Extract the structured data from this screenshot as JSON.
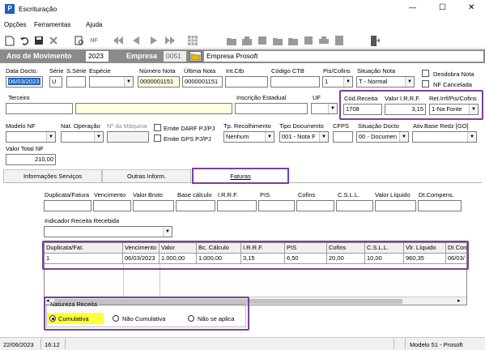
{
  "window": {
    "title": "Escrituração",
    "minimize": "—",
    "maximize": "☐",
    "close": "✕"
  },
  "menu": [
    "Opções",
    "Ferramentas",
    "Ajuda"
  ],
  "movement": {
    "label": "Ano de Movimento",
    "year": "2023",
    "company_label": "Empresa",
    "company_code": "0051",
    "company_name": "Empresa Prosoft"
  },
  "row1": {
    "data_docto_label": "Data Docto.",
    "data_docto": "06/03/2023",
    "serie_label": "Série",
    "serie": "U",
    "subserie_label": "S.Série",
    "especie_label": "Espécie",
    "numero_nota_label": "Número Nota",
    "numero_nota": "0000001151",
    "ultima_nota_label": "Última Nota",
    "ultima_nota": "0000001151",
    "int_ctb_label": "Int.Ctb",
    "cod_ctb_label": "Código CTB",
    "pis_cofins_label": "Pis/Cofins",
    "pis_cofins": "1",
    "situacao_label": "Situação Nota",
    "situacao": "T - Normal",
    "desdobra_label": "Desdobra Nota",
    "cancelada_label": "NF Cancelada"
  },
  "row2": {
    "terceiro_label": "Terceiro",
    "insc_label": "Inscrição Estadual",
    "uf_label": "UF",
    "cod_receita_label": "Cód.Receita",
    "cod_receita": "1708",
    "valor_irrf_label": "Valor I.R.R.F.",
    "valor_irrf": "3,15",
    "ret_label": "Ret.Irrf/Pis/Cofins",
    "ret": "1-Na Fonte"
  },
  "row3": {
    "modelo_label": "Modelo NF",
    "nat_op_label": "Nat. Operação",
    "maquina_label": "Nº da Máquina",
    "darf_label": "Emite DARF PJ/PJ",
    "gps_label": "Emite GPS PJ/PJ",
    "tp_rec_label": "Tp. Recolhimento",
    "tp_rec": "Nenhum",
    "tipo_doc_label": "Tipo Documento",
    "tipo_doc": "001 - Nota F",
    "cfps_label": "CFPS",
    "sit_doc_label": "Situação Docto",
    "sit_doc": "00 - Documen",
    "ativ_label": "Ativ.Base Redz [GO]"
  },
  "row4": {
    "valor_total_label": "Valor Total NF",
    "valor_total": "210,00"
  },
  "tabs": [
    "Informações Serviços",
    "Outras Inform.",
    "Faturas"
  ],
  "fatura_form": {
    "labels": [
      "Duplicata/Fatura",
      "Vencimento",
      "Valor Bruto",
      "Base cálculo",
      "I.R.R.F.",
      "PIS",
      "Cofins",
      "C.S.L.L.",
      "Valor Líquido",
      "Dt.Compens."
    ],
    "indicador_label": "Indicador Receita Recebida"
  },
  "grid": {
    "headers": [
      "Duplicata/Fat.",
      "Vencimento",
      "Valor",
      "Bc. Cálculo",
      "I.R.R.F.",
      "PIS",
      "Cofins",
      "C.S.L.L.",
      "Vlr. Líquido",
      "Dt Com"
    ],
    "row": [
      "1",
      "06/03/2023",
      "1.000,00",
      "1.000,00",
      "3,15",
      "6,50",
      "20,00",
      "10,00",
      "960,35",
      "06/03/"
    ]
  },
  "natureza": {
    "legend": "Natureza Receita",
    "options": [
      "Cumulativa",
      "Não Cumulativa",
      "Não se aplica"
    ],
    "selected": "Cumulativa"
  },
  "status": {
    "date": "22/06/2023",
    "time": "16:12",
    "model": "Modelo 51 - Prosoft"
  }
}
